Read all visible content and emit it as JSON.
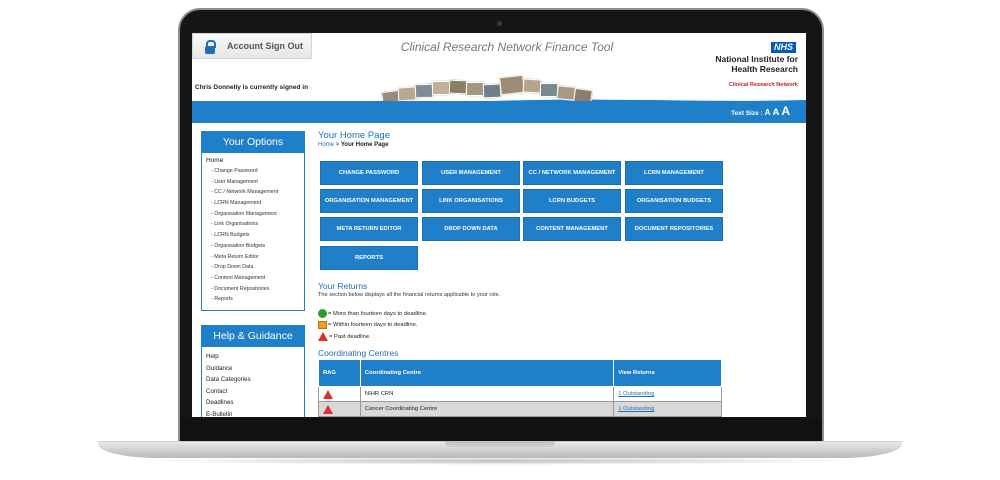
{
  "header": {
    "sign_out_label": "Account Sign Out",
    "app_title": "Clinical Research Network Finance Tool",
    "nhs_badge": "NHS",
    "org_name_line1": "National Institute for",
    "org_name_line2": "Health Research",
    "org_subname": "Clinical Research Network",
    "signed_in_text": "Chris Donnelly is currently signed in",
    "text_size_label": "Text Size :",
    "text_size_options": [
      "A",
      "A",
      "A"
    ]
  },
  "options_panel": {
    "title": "Your Options",
    "home": "Home",
    "items": [
      "Change Password",
      "User Management",
      "CC / Network Management",
      "LCRN Management",
      "Organisation Management",
      "Link Organisations",
      "LCRN Budgets",
      "Organisation Budgets",
      "Meta Return Editor",
      "Drop Down Data",
      "Content Management",
      "Document Repositories",
      "Reports"
    ],
    "bullet": "-"
  },
  "help_panel": {
    "title": "Help & Guidance",
    "items": [
      "Help",
      "Guidance",
      "Data Categories",
      "Contact",
      "Deadlines",
      "E-Bulletin"
    ]
  },
  "main": {
    "page_title": "Your Home Page",
    "breadcrumb_home": "Home",
    "breadcrumb_sep": " > ",
    "breadcrumb_current": "Your Home Page",
    "buttons": [
      "CHANGE PASSWORD",
      "USER MANAGEMENT",
      "CC / NETWORK MANAGEMENT",
      "LCRN MANAGEMENT",
      "ORGANISATION MANAGEMENT",
      "LINK ORGANISATIONS",
      "LCRN BUDGETS",
      "ORGANISATION BUDGETS",
      "META RETURN EDITOR",
      "DROP DOWN DATA",
      "CONTENT MANAGEMENT",
      "DOCUMENT REPOSITORIES",
      "REPORTS"
    ],
    "returns_title": "Your Returns",
    "returns_intro": "The section below displays all the financial returns applicable to your role.",
    "legend": [
      "= More than fourteen days to deadline.",
      "= Within fourteen days to deadline.",
      "= Past deadline."
    ],
    "cc_title": "Coordinating Centres",
    "table": {
      "headers": [
        "RAG",
        "Coordinating Centre",
        "View Returns"
      ],
      "rows": [
        {
          "centre": "NIHR CRN",
          "returns": "1 Outstanding",
          "rag": "red"
        },
        {
          "centre": "Cancer Coordinating Centre",
          "returns": "1 Outstanding",
          "rag": "red"
        }
      ]
    }
  },
  "colors": {
    "brand_blue": "#1f7fc9",
    "nhs_blue": "#005eb8",
    "rag_green": "#2aa02a",
    "rag_amber": "#f39a2b",
    "rag_red": "#d8332a"
  }
}
